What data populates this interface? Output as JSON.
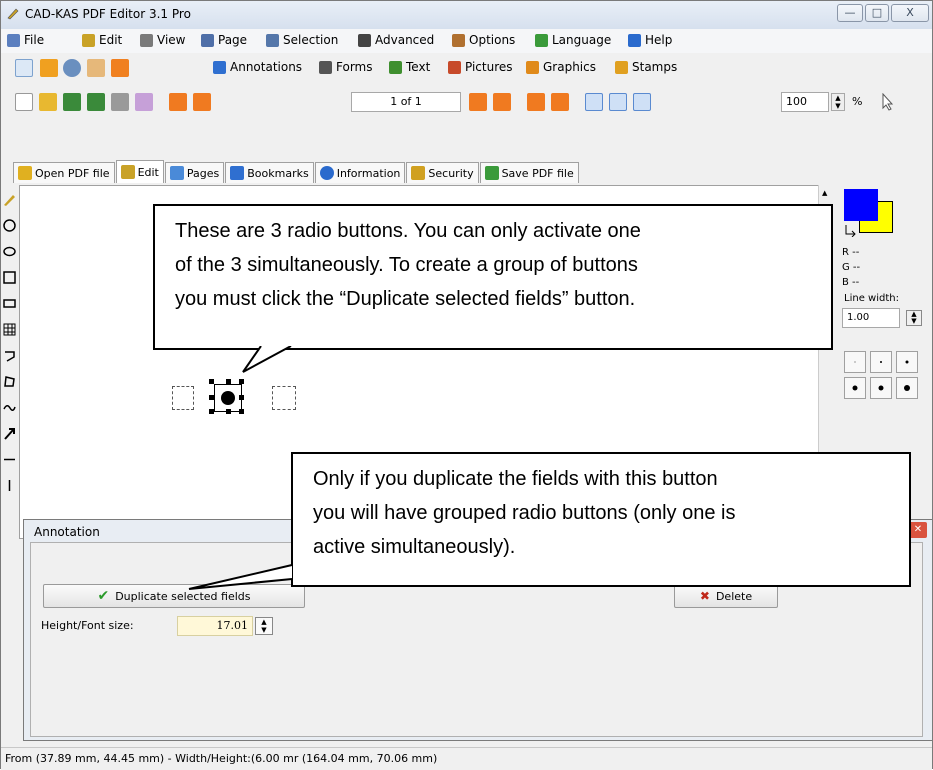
{
  "window": {
    "title": "CAD-KAS PDF Editor 3.1 Pro",
    "controls": [
      "—",
      "□",
      "X"
    ]
  },
  "menu": [
    {
      "label": "File",
      "icon": "file-icon",
      "color": "#5b7fbf"
    },
    {
      "label": "Edit",
      "icon": "edit-icon",
      "color": "#c9a227"
    },
    {
      "label": "View",
      "icon": "view-icon",
      "color": "#7a7a7a"
    },
    {
      "label": "Page",
      "icon": "page-icon",
      "color": "#4f6fa8"
    },
    {
      "label": "Selection",
      "icon": "selection-icon",
      "color": "#5577aa"
    },
    {
      "label": "Advanced",
      "icon": "advanced-icon",
      "color": "#444"
    },
    {
      "label": "Options",
      "icon": "options-icon",
      "color": "#b07030"
    },
    {
      "label": "Language",
      "icon": "language-icon",
      "color": "#3a9a3a"
    },
    {
      "label": "Help",
      "icon": "help-icon",
      "color": "#2a6acd"
    }
  ],
  "toolbar1": {
    "items": [
      {
        "label": "Annotations",
        "icon": "annotations-icon",
        "color": "#2f6fd0"
      },
      {
        "label": "Forms",
        "icon": "forms-icon",
        "color": "#555"
      },
      {
        "label": "Text",
        "icon": "text-icon",
        "color": "#3f8f2f"
      },
      {
        "label": "Pictures",
        "icon": "pictures-icon",
        "color": "#c74a2a"
      },
      {
        "label": "Graphics",
        "icon": "graphics-icon",
        "color": "#e08a1a"
      },
      {
        "label": "Stamps",
        "icon": "stamps-icon",
        "color": "#e0a020"
      }
    ]
  },
  "toolbar2": {
    "page_indicator": "1 of 1",
    "zoom": "100",
    "zoom_unit": "%"
  },
  "tabs": [
    {
      "label": "Open PDF file",
      "icon": "open-folder-icon",
      "color": "#e0b020"
    },
    {
      "label": "Edit",
      "icon": "edit-icon",
      "color": "#c9a227"
    },
    {
      "label": "Pages",
      "icon": "pages-icon",
      "color": "#4a8ad8"
    },
    {
      "label": "Bookmarks",
      "icon": "bookmarks-icon",
      "color": "#2f6fd0"
    },
    {
      "label": "Information",
      "icon": "information-icon",
      "color": "#2a6acd"
    },
    {
      "label": "Security",
      "icon": "security-icon",
      "color": "#d0a020"
    },
    {
      "label": "Save PDF file",
      "icon": "save-icon",
      "color": "#3a9a3a"
    }
  ],
  "right_panel": {
    "fg_color": "#0000ff",
    "bg_color": "#ffff00",
    "r": "R --",
    "g": "G --",
    "b": "B --",
    "line_width_label": "Line width:",
    "line_width_value": "1.00"
  },
  "callout_top": [
    "These are 3 radio buttons. You can only activate one",
    "of the 3 simultaneously. To create a group of buttons",
    "you must click the “Duplicate selected fields” button."
  ],
  "callout_bottom": [
    "Only if you duplicate the fields with this button",
    "you will have grouped radio buttons (only one is",
    "active simultaneously)."
  ],
  "dialog": {
    "title": "Annotation",
    "duplicate_label": "Duplicate selected fields",
    "delete_label": "Delete",
    "height_label": "Height/Font size:",
    "height_value": "17.01"
  },
  "status": "From (37.89 mm, 44.45 mm) - Width/Height:(6.00 mr (164.04 mm, 70.06 mm)"
}
